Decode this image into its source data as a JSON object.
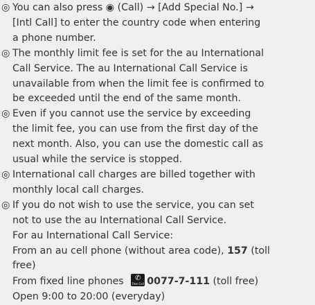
{
  "note_mark": "◎",
  "notes": [
    {
      "lines": [
        [
          "You can also press ",
          "◉",
          " (Call) → [Add Special No.] →"
        ],
        [
          "[Intl Call] to enter the country code when entering"
        ],
        [
          "a phone number."
        ]
      ]
    },
    {
      "lines": [
        [
          "The monthly limit fee is set for the au International"
        ],
        [
          "Call Service. The au International Call Service is"
        ],
        [
          "unavailable from when the limit fee is confirmed to"
        ],
        [
          "be exceeded until the end of the same month."
        ]
      ]
    },
    {
      "lines": [
        [
          "Even if you cannot use the service by exceeding"
        ],
        [
          "the limit fee, you can use from the first day of the"
        ],
        [
          "next month. Also, you can use the domestic call as"
        ],
        [
          "usual while the service is stopped."
        ]
      ]
    },
    {
      "lines": [
        [
          "International call charges are billed together with"
        ],
        [
          "monthly local call charges."
        ]
      ]
    },
    {
      "lines": [
        [
          "If you do not wish to use the service, you can set"
        ],
        [
          "not to use the au International Call Service."
        ],
        [
          "For au International Call Service:"
        ],
        [
          "From an au cell phone (without area code), ",
          "157",
          " (toll"
        ],
        [
          "free)"
        ],
        [
          "From fixed line phones ",
          "0077-7-111",
          " (toll free)"
        ],
        [
          "Open 9:00 to 20:00 (everyday)"
        ]
      ]
    }
  ],
  "free_call_icon": {
    "name": "free-call-icon",
    "text": "Free Call"
  }
}
